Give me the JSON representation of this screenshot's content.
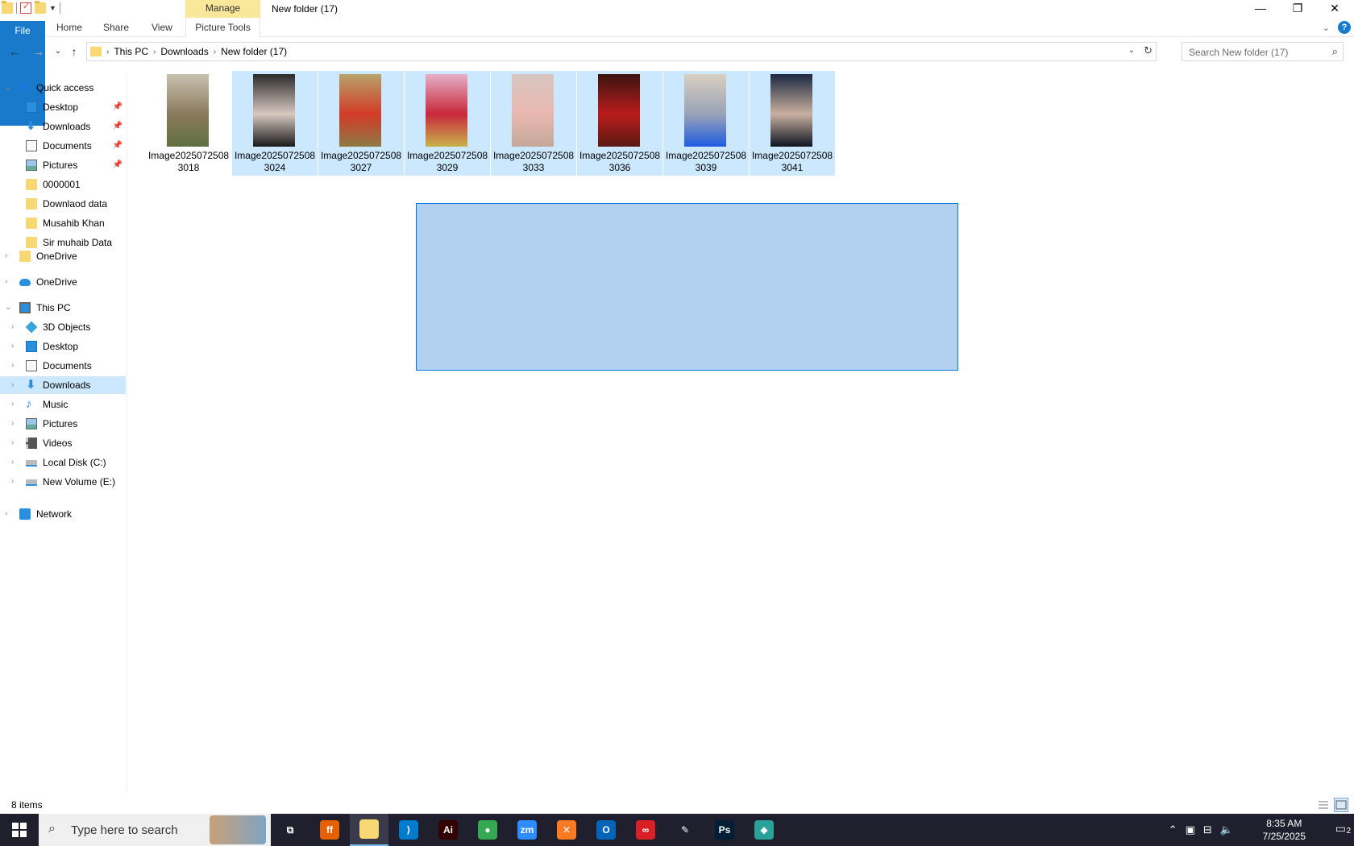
{
  "window": {
    "title": "New folder (17)",
    "manage_label": "Manage",
    "minimize": "—",
    "restore": "❐",
    "close": "✕"
  },
  "ribbon": {
    "tabs": [
      "File",
      "Home",
      "Share",
      "View",
      "Picture Tools"
    ],
    "help": "?",
    "collapse": "⌄"
  },
  "nav": {
    "back": "←",
    "forward": "→",
    "recent": "⌄",
    "up": "↑",
    "breadcrumbs": [
      "This PC",
      "Downloads",
      "New folder (17)"
    ],
    "crumb_sep": "›",
    "refresh": "↻",
    "search_placeholder": "Search New folder (17)"
  },
  "sidebar": {
    "quick_access": "Quick access",
    "quick_items": [
      {
        "label": "Desktop",
        "icon": "desktop-icon",
        "pinned": true
      },
      {
        "label": "Downloads",
        "icon": "downloads-icon",
        "pinned": true
      },
      {
        "label": "Documents",
        "icon": "documents-icon",
        "pinned": true
      },
      {
        "label": "Pictures",
        "icon": "pictures-icon",
        "pinned": true
      },
      {
        "label": "0000001",
        "icon": "folder-icon",
        "pinned": false
      },
      {
        "label": "Downlaod data",
        "icon": "folder-icon",
        "pinned": false
      },
      {
        "label": "Musahib Khan",
        "icon": "folder-icon",
        "pinned": false
      },
      {
        "label": "Sir muhaib Data",
        "icon": "folder-icon",
        "pinned": false
      }
    ],
    "onedrive_personal": "OneDrive",
    "onedrive_cloud": "OneDrive",
    "this_pc": "This PC",
    "pc_items": [
      {
        "label": "3D Objects",
        "icon": "3d-objects-icon"
      },
      {
        "label": "Desktop",
        "icon": "desktop-icon"
      },
      {
        "label": "Documents",
        "icon": "documents-icon"
      },
      {
        "label": "Downloads",
        "icon": "downloads-icon",
        "selected": true
      },
      {
        "label": "Music",
        "icon": "music-icon"
      },
      {
        "label": "Pictures",
        "icon": "pictures-icon"
      },
      {
        "label": "Videos",
        "icon": "videos-icon"
      },
      {
        "label": "Local Disk (C:)",
        "icon": "local-disk-icon"
      },
      {
        "label": "New Volume (E:)",
        "icon": "drive-icon"
      }
    ],
    "network": "Network",
    "pin_glyph": "📌",
    "expand_glyph": "›",
    "collapse_glyph": "⌄"
  },
  "files": [
    {
      "name": "Image20250725083018",
      "selected": false,
      "colors": [
        "#c9c2b0",
        "#8a7a5c",
        "#5f7040"
      ]
    },
    {
      "name": "Image20250725083024",
      "selected": true,
      "colors": [
        "#2a2a2a",
        "#d8c8c0",
        "#1a1a1a"
      ]
    },
    {
      "name": "Image20250725083027",
      "selected": true,
      "colors": [
        "#b7a36a",
        "#d23a26",
        "#8d7a45"
      ]
    },
    {
      "name": "Image20250725083029",
      "selected": true,
      "colors": [
        "#e6b0c6",
        "#c8283c",
        "#c9b24a"
      ]
    },
    {
      "name": "Image20250725083033",
      "selected": true,
      "colors": [
        "#d8c6c0",
        "#e9b8b0",
        "#c4a89a"
      ]
    },
    {
      "name": "Image20250725083036",
      "selected": true,
      "colors": [
        "#3a1410",
        "#b91c1c",
        "#5a1a12"
      ]
    },
    {
      "name": "Image20250725083039",
      "selected": true,
      "colors": [
        "#d8cfc0",
        "#9aa2b8",
        "#1e5ce0"
      ]
    },
    {
      "name": "Image20250725083041",
      "selected": true,
      "colors": [
        "#1a2840",
        "#c9b0a0",
        "#0e1520"
      ]
    }
  ],
  "status": {
    "count": "8 items"
  },
  "taskbar": {
    "search_placeholder": "Type here to search",
    "apps": [
      {
        "name": "task-view",
        "glyph": "⧉",
        "color": "#1f1f2e"
      },
      {
        "name": "firefox",
        "glyph": "ff",
        "color": "#e66000"
      },
      {
        "name": "file-explorer",
        "glyph": "",
        "color": "#f8d775",
        "active": true
      },
      {
        "name": "vscode",
        "glyph": "⟩",
        "color": "#007acc"
      },
      {
        "name": "illustrator",
        "glyph": "Ai",
        "color": "#330000"
      },
      {
        "name": "chrome",
        "glyph": "●",
        "color": "#34a853"
      },
      {
        "name": "zoom",
        "glyph": "zm",
        "color": "#2d8cff"
      },
      {
        "name": "xampp",
        "glyph": "✕",
        "color": "#fb7a24"
      },
      {
        "name": "outlook",
        "glyph": "O",
        "color": "#0364b8"
      },
      {
        "name": "creative-cloud",
        "glyph": "∞",
        "color": "#da1f26"
      },
      {
        "name": "pen-tool",
        "glyph": "✎",
        "color": "#1f1f2e"
      },
      {
        "name": "photoshop",
        "glyph": "Ps",
        "color": "#001e36"
      },
      {
        "name": "app",
        "glyph": "◆",
        "color": "#2aa198"
      }
    ],
    "time": "8:35 AM",
    "date": "7/25/2025",
    "notifications": "2"
  }
}
